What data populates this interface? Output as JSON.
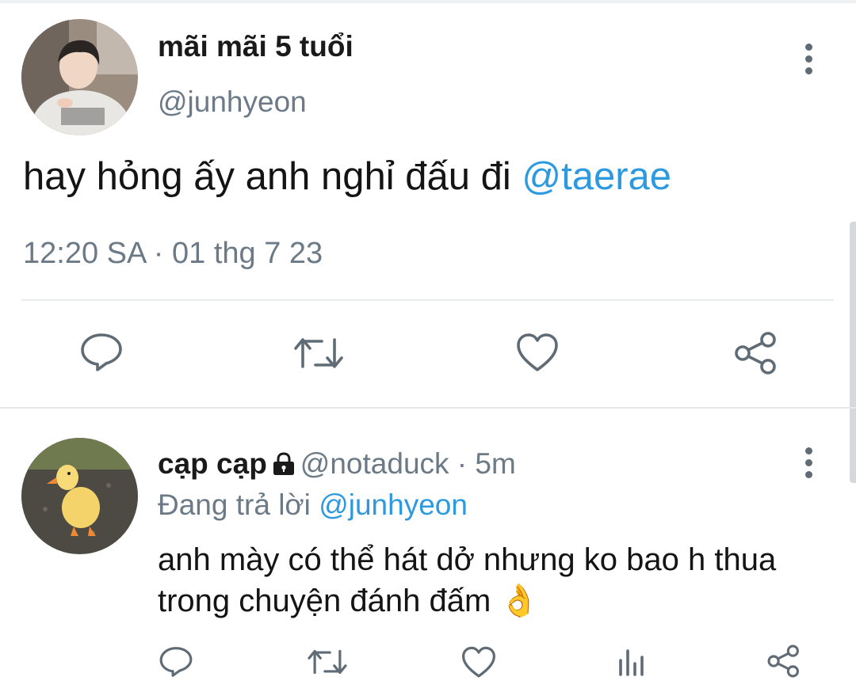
{
  "tweet1": {
    "author_name": "mãi mãi 5 tuổi",
    "author_handle": "@junhyeon",
    "text_main": "hay hỏng ấy anh nghỉ đấu đi ",
    "text_mention": "@taerae",
    "timestamp": "12:20 SA · 01 thg 7 23",
    "actions": {
      "reply": "reply-icon",
      "retweet": "retweet-icon",
      "like": "heart-icon",
      "share": "share-icon"
    }
  },
  "tweet2": {
    "author_name": "cạp cạp",
    "author_handle": "@notaduck",
    "separator": " · ",
    "age": "5m",
    "reply_prefix": "Đang trả lời ",
    "reply_to": "@junhyeon",
    "text": "anh mày có thể hát dở nhưng ko bao h thua trong chuyện đánh đấm",
    "emoji": "👌",
    "actions": {
      "reply": "reply-icon",
      "retweet": "retweet-icon",
      "like": "heart-icon",
      "analytics": "bar-chart-icon",
      "share": "share-icon"
    }
  },
  "colors": {
    "accent": "#2d9ae0",
    "muted": "#6b7a86",
    "icon": "#5f6b75"
  }
}
